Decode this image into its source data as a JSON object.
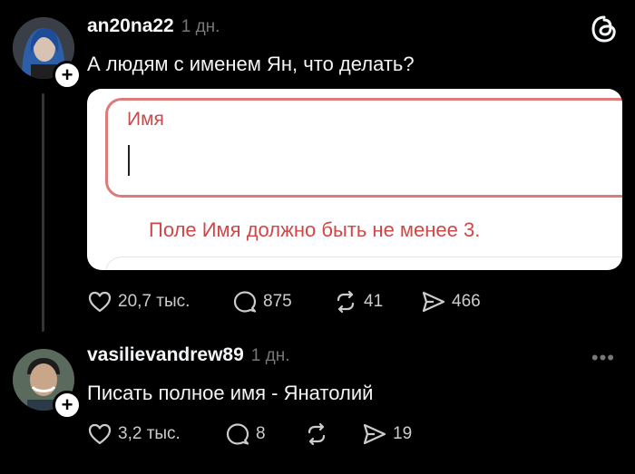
{
  "posts": [
    {
      "username": "an20na22",
      "time": "1 дн.",
      "text": "А людям с именем Ян, что делать?",
      "image": {
        "field_label": "Имя",
        "error_text": "Поле Имя должно быть не менее 3."
      },
      "likes": "20,7 тыс.",
      "replies": "875",
      "reposts": "41",
      "shares": "466"
    },
    {
      "username": "vasilievandrew89",
      "time": "1 дн.",
      "text": "Писать полное имя - Янатолий",
      "likes": "3,2 тыс.",
      "replies": "8",
      "reposts": "",
      "shares": "19"
    }
  ],
  "more_icon_text": "•••",
  "colors": {
    "background": "#000000",
    "error_red": "#d14646",
    "muted": "#777777"
  }
}
